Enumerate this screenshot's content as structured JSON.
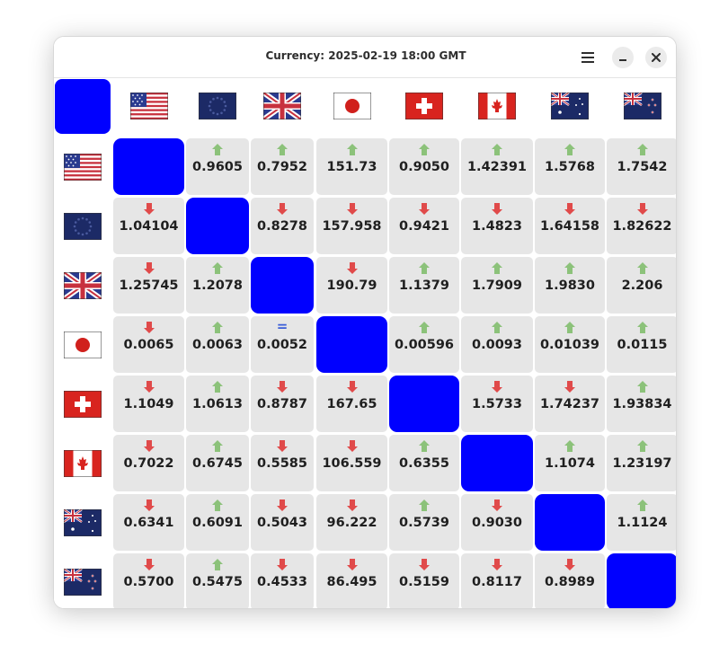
{
  "window": {
    "title": "Currency: 2025-02-19 18:00 GMT"
  },
  "titlebar": {
    "menu_icon": "hamburger-menu-icon",
    "minimize_icon": "minimize-icon",
    "close_icon": "close-icon"
  },
  "colors": {
    "diagonal": "#0000ff",
    "cell_bg": "#e6e6e6",
    "up_arrow": "#8cc27a",
    "down_arrow": "#e04a4a",
    "equal_sign": "#3a5dd8"
  },
  "currencies": [
    {
      "flag": "flag-usa-icon"
    },
    {
      "flag": "flag-euro-icon"
    },
    {
      "flag": "flag-uk-icon"
    },
    {
      "flag": "flag-japan-icon"
    },
    {
      "flag": "flag-switzerland-icon"
    },
    {
      "flag": "flag-canada-icon"
    },
    {
      "flag": "flag-australia-icon"
    },
    {
      "flag": "flag-new-zealand-icon"
    }
  ],
  "rows": [
    {
      "values": [
        "",
        "0.9605",
        "0.7952",
        "151.73",
        "0.9050",
        "1.42391",
        "1.5768",
        "1.7542"
      ],
      "trend": [
        "",
        "up",
        "up",
        "up",
        "up",
        "up",
        "up",
        "up"
      ]
    },
    {
      "values": [
        "1.04104",
        "",
        "0.8278",
        "157.958",
        "0.9421",
        "1.4823",
        "1.64158",
        "1.82622"
      ],
      "trend": [
        "down",
        "",
        "down",
        "down",
        "down",
        "down",
        "down",
        "down"
      ]
    },
    {
      "values": [
        "1.25745",
        "1.2078",
        "",
        "190.79",
        "1.1379",
        "1.7909",
        "1.9830",
        "2.206"
      ],
      "trend": [
        "down",
        "up",
        "",
        "down",
        "up",
        "up",
        "up",
        "up"
      ]
    },
    {
      "values": [
        "0.0065",
        "0.0063",
        "0.0052",
        "",
        "0.00596",
        "0.0093",
        "0.01039",
        "0.0115"
      ],
      "trend": [
        "down",
        "up",
        "equal",
        "",
        "up",
        "up",
        "up",
        "up"
      ]
    },
    {
      "values": [
        "1.1049",
        "1.0613",
        "0.8787",
        "167.65",
        "",
        "1.5733",
        "1.74237",
        "1.93834"
      ],
      "trend": [
        "down",
        "up",
        "down",
        "down",
        "",
        "down",
        "down",
        "up"
      ]
    },
    {
      "values": [
        "0.7022",
        "0.6745",
        "0.5585",
        "106.559",
        "0.6355",
        "",
        "1.1074",
        "1.23197"
      ],
      "trend": [
        "down",
        "up",
        "down",
        "down",
        "up",
        "",
        "up",
        "up"
      ]
    },
    {
      "values": [
        "0.6341",
        "0.6091",
        "0.5043",
        "96.222",
        "0.5739",
        "0.9030",
        "",
        "1.1124"
      ],
      "trend": [
        "down",
        "up",
        "down",
        "down",
        "up",
        "down",
        "",
        "up"
      ]
    },
    {
      "values": [
        "0.5700",
        "0.5475",
        "0.4533",
        "86.495",
        "0.5159",
        "0.8117",
        "0.8989",
        ""
      ],
      "trend": [
        "down",
        "up",
        "down",
        "down",
        "down",
        "down",
        "down",
        ""
      ]
    }
  ]
}
